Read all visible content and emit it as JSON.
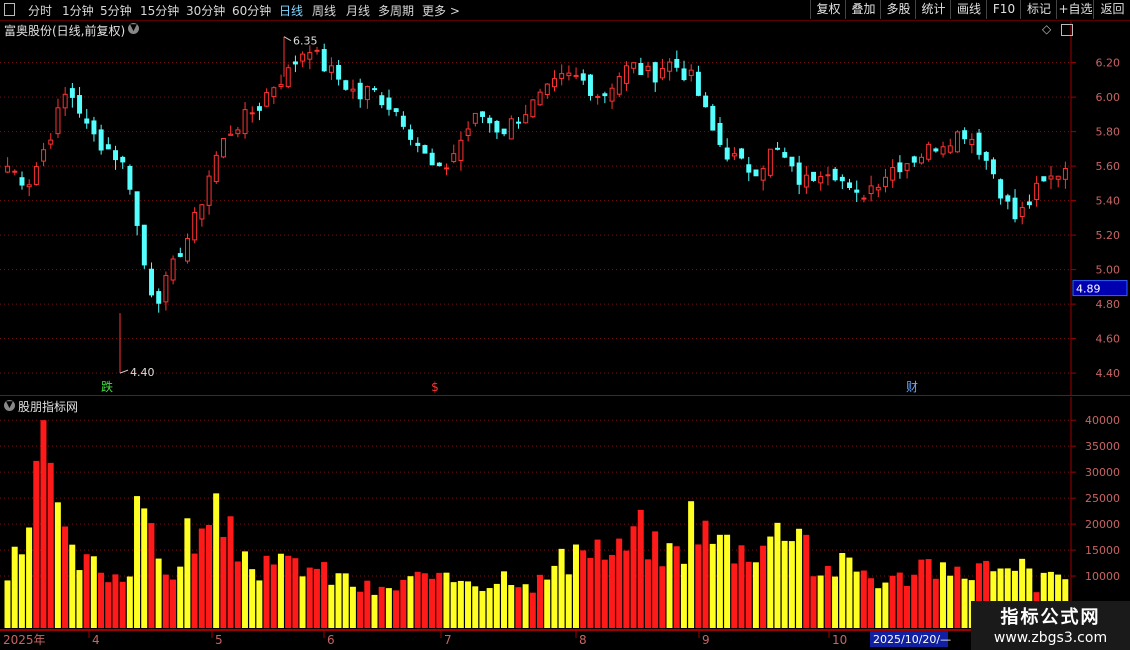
{
  "toolbar": {
    "periods": [
      "分时",
      "1分钟",
      "5分钟",
      "15分钟",
      "30分钟",
      "60分钟",
      "日线",
      "周线",
      "月线",
      "多周期",
      "更多 >"
    ],
    "active": "日线",
    "buttons": [
      "复权",
      "叠加",
      "多股",
      "统计",
      "画线",
      "F10",
      "标记",
      "+自选",
      "返回"
    ]
  },
  "price_panel": {
    "title": "富奥股份(日线,前复权)",
    "y_ticks": [
      "6.20",
      "6.00",
      "5.80",
      "5.60",
      "5.40",
      "5.20",
      "5.00",
      "4.80",
      "4.60",
      "4.40"
    ],
    "current_price": "4.89",
    "high_label": "6.35",
    "low_label": "4.40",
    "markers": [
      {
        "text": "跌",
        "color": "#44dd44"
      },
      {
        "text": "$",
        "color": "#ff3333"
      },
      {
        "text": "财",
        "color": "#66aaff"
      }
    ]
  },
  "volume_panel": {
    "title": "股朋指标网",
    "y_ticks": [
      "40000",
      "35000",
      "30000",
      "25000",
      "20000",
      "15000",
      "10000"
    ]
  },
  "date_axis": {
    "labels": [
      "2025年",
      "4",
      "5",
      "6",
      "7",
      "8",
      "9",
      "10"
    ],
    "current_date": "2025/10/20/—"
  },
  "watermark": {
    "line1": "指标公式网",
    "line2": "www.zbgs3.com"
  },
  "colors": {
    "up": "#ff3232",
    "down": "#54ffff",
    "vol_up": "#ff1a1a",
    "vol_down": "#ffff22",
    "grid": "#7a1010",
    "axis": "#a00000",
    "text": "#c8c8c8"
  },
  "chart_data": {
    "type": "candlestick",
    "price_ylim": [
      4.36,
      6.36
    ],
    "volume_ylim": [
      0,
      41000
    ],
    "high": 6.35,
    "low": 4.4,
    "close_path": [
      5.6,
      5.55,
      5.5,
      5.62,
      5.75,
      5.9,
      6.05,
      5.95,
      5.8,
      5.75,
      5.7,
      5.65,
      5.55,
      5.2,
      4.9,
      4.85,
      4.95,
      5.1,
      5.2,
      5.35,
      5.55,
      5.7,
      5.8,
      5.85,
      5.9,
      5.95,
      6.05,
      6.1,
      6.15,
      6.25,
      6.3,
      6.2,
      6.15,
      6.1,
      6.05,
      6.0,
      6.05,
      6.0,
      5.95,
      5.9,
      5.8,
      5.7,
      5.6,
      5.55,
      5.65,
      5.75,
      5.85,
      5.9,
      5.85,
      5.8,
      5.85,
      5.9,
      5.95,
      6.0,
      6.05,
      6.1,
      6.12,
      6.1,
      6.05,
      6.0,
      6.08,
      6.15,
      6.18,
      6.15,
      6.12,
      6.18,
      6.2,
      6.15,
      6.1,
      5.95,
      5.8,
      5.7,
      5.65,
      5.6,
      5.58,
      5.62,
      5.7,
      5.65,
      5.55,
      5.5,
      5.55,
      5.6,
      5.58,
      5.5,
      5.4,
      5.45,
      5.5,
      5.55,
      5.6,
      5.62,
      5.65,
      5.68,
      5.72,
      5.75,
      5.78,
      5.8,
      5.75,
      5.65,
      5.55,
      5.4,
      5.3,
      5.35,
      5.45,
      5.5,
      5.55,
      5.6
    ],
    "volume_envelope": [
      10000,
      14000,
      12000,
      38000,
      39000,
      22000,
      14000,
      13000,
      12000,
      12000,
      11000,
      10000,
      10000,
      31000,
      18000,
      13000,
      12000,
      10000,
      20000,
      17000,
      19000,
      22000,
      18000,
      15000,
      14000,
      12000,
      11000,
      12000,
      12000,
      13000,
      12000,
      11000,
      10000,
      10000,
      9000,
      8000,
      7500,
      7000,
      7000,
      9000,
      10000,
      9500,
      9000,
      8500,
      9000,
      10000,
      10000,
      9000,
      9000,
      10000,
      11000,
      10000,
      9000,
      9000,
      11000,
      13000,
      12000,
      14000,
      17000,
      15000,
      14000,
      15000,
      18000,
      19000,
      16000,
      14000,
      15000,
      15000,
      23000,
      19000,
      17000,
      17000,
      16000,
      15000,
      16000,
      17000,
      18000,
      19000,
      22000,
      20000,
      12000,
      11000,
      12000,
      12000,
      12000,
      11000,
      10000,
      9000,
      9000,
      10000,
      12000,
      13000,
      12000,
      10000,
      10000,
      11000,
      12000,
      12000,
      10000,
      10000,
      11000,
      12000,
      9000,
      9000,
      10000,
      10000
    ]
  }
}
